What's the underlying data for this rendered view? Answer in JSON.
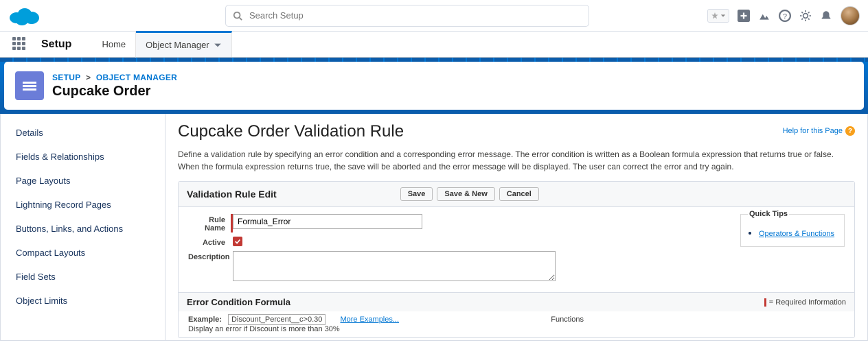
{
  "search": {
    "placeholder": "Search Setup"
  },
  "nav": {
    "setup": "Setup",
    "home": "Home",
    "objectManager": "Object Manager"
  },
  "crumbs": {
    "setup": "SETUP",
    "sep": ">",
    "objMgr": "OBJECT MANAGER"
  },
  "objectTitle": "Cupcake Order",
  "sidebar": {
    "items": [
      "Details",
      "Fields & Relationships",
      "Page Layouts",
      "Lightning Record Pages",
      "Buttons, Links, and Actions",
      "Compact Layouts",
      "Field Sets",
      "Object Limits"
    ]
  },
  "page": {
    "heading": "Cupcake Order Validation Rule",
    "helpLink": "Help for this Page",
    "intro": "Define a validation rule by specifying an error condition and a corresponding error message. The error condition is written as a Boolean formula expression that returns true or false. When the formula expression returns true, the save will be aborted and the error message will be displayed. The user can correct the error and try again."
  },
  "panel": {
    "title": "Validation Rule Edit",
    "buttons": {
      "save": "Save",
      "saveNew": "Save & New",
      "cancel": "Cancel"
    }
  },
  "form": {
    "ruleNameLabel": "Rule Name",
    "ruleNameValue": "Formula_Error",
    "activeLabel": "Active",
    "descriptionLabel": "Description",
    "descriptionValue": ""
  },
  "tips": {
    "legend": "Quick Tips",
    "link": "Operators & Functions"
  },
  "cond": {
    "title": "Error Condition Formula",
    "reqInfo": "= Required Information"
  },
  "example": {
    "label": "Example:",
    "code": "Discount_Percent__c>0.30",
    "moreLink": "More Examples...",
    "note": "Display an error if Discount is more than 30%",
    "functionsLabel": "Functions"
  }
}
